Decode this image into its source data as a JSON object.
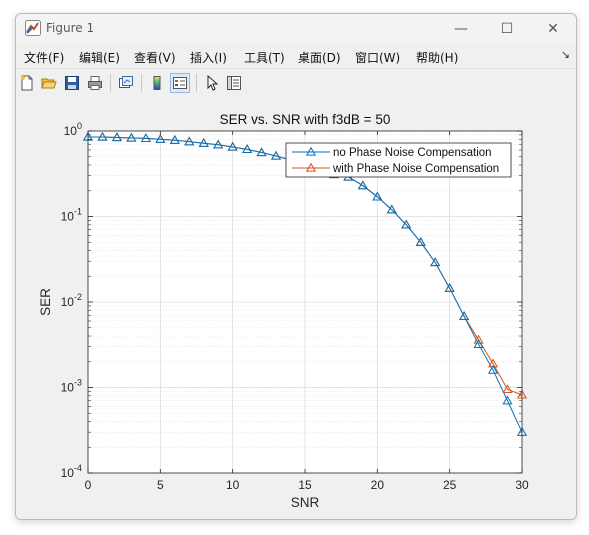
{
  "window": {
    "title": "Figure 1",
    "minimize_glyph": "—",
    "maximize_glyph": "☐",
    "close_glyph": "✕"
  },
  "menu": {
    "items": [
      "文件(F)",
      "编辑(E)",
      "查看(V)",
      "插入(I)",
      "工具(T)",
      "桌面(D)",
      "窗口(W)",
      "帮助(H)"
    ],
    "dock_glyph": "↘"
  },
  "toolbar": {
    "buttons": [
      "new-figure-icon",
      "open-file-icon",
      "save-icon",
      "print-icon",
      "link-plot-icon",
      "colorbar-icon",
      "legend-icon",
      "select-arrow-icon",
      "property-inspector-icon"
    ]
  },
  "colors": {
    "series1": "#0072bd",
    "series2": "#d95319",
    "grid": "#dcdcdc"
  },
  "chart_data": {
    "type": "line",
    "title": "SER vs. SNR with f3dB = 50",
    "xlabel": "SNR",
    "ylabel": "SER",
    "xlim": [
      0,
      30
    ],
    "ylim": [
      0.0001,
      1
    ],
    "yscale": "log",
    "xticks": [
      0,
      5,
      10,
      15,
      20,
      25,
      30
    ],
    "xtick_labels": [
      "0",
      "5",
      "10",
      "15",
      "20",
      "25",
      "30"
    ],
    "yticks": [
      0.0001,
      0.001,
      0.01,
      0.1,
      1
    ],
    "ytick_labels": [
      {
        "base": "10",
        "exp": "-4"
      },
      {
        "base": "10",
        "exp": "-3"
      },
      {
        "base": "10",
        "exp": "-2"
      },
      {
        "base": "10",
        "exp": "-1"
      },
      {
        "base": "10",
        "exp": "0"
      }
    ],
    "grid": true,
    "legend_position": "top-right",
    "x": [
      0,
      1,
      2,
      3,
      4,
      5,
      6,
      7,
      8,
      9,
      10,
      11,
      12,
      13,
      14,
      15,
      16,
      17,
      18,
      19,
      20,
      21,
      22,
      23,
      24,
      25,
      26,
      27,
      28,
      29,
      30
    ],
    "series": [
      {
        "name": "no Phase Noise Compensation",
        "marker": "triangle",
        "values": [
          0.85,
          0.85,
          0.84,
          0.83,
          0.82,
          0.8,
          0.78,
          0.75,
          0.72,
          0.69,
          0.65,
          0.61,
          0.56,
          0.51,
          0.46,
          0.41,
          0.36,
          0.31,
          0.29,
          0.23,
          0.17,
          0.12,
          0.08,
          0.05,
          0.029,
          0.0145,
          0.0068,
          0.0032,
          0.0016,
          0.0007,
          0.0003
        ]
      },
      {
        "name": "with Phase Noise Compensation",
        "marker": "triangle",
        "values": [
          0.85,
          0.85,
          0.84,
          0.83,
          0.82,
          0.8,
          0.78,
          0.75,
          0.72,
          0.69,
          0.65,
          0.61,
          0.56,
          0.51,
          0.46,
          0.41,
          0.36,
          0.31,
          0.29,
          0.23,
          0.17,
          0.12,
          0.08,
          0.05,
          0.029,
          0.0145,
          0.0068,
          0.0036,
          0.0019,
          0.00095,
          0.00082
        ]
      }
    ]
  }
}
